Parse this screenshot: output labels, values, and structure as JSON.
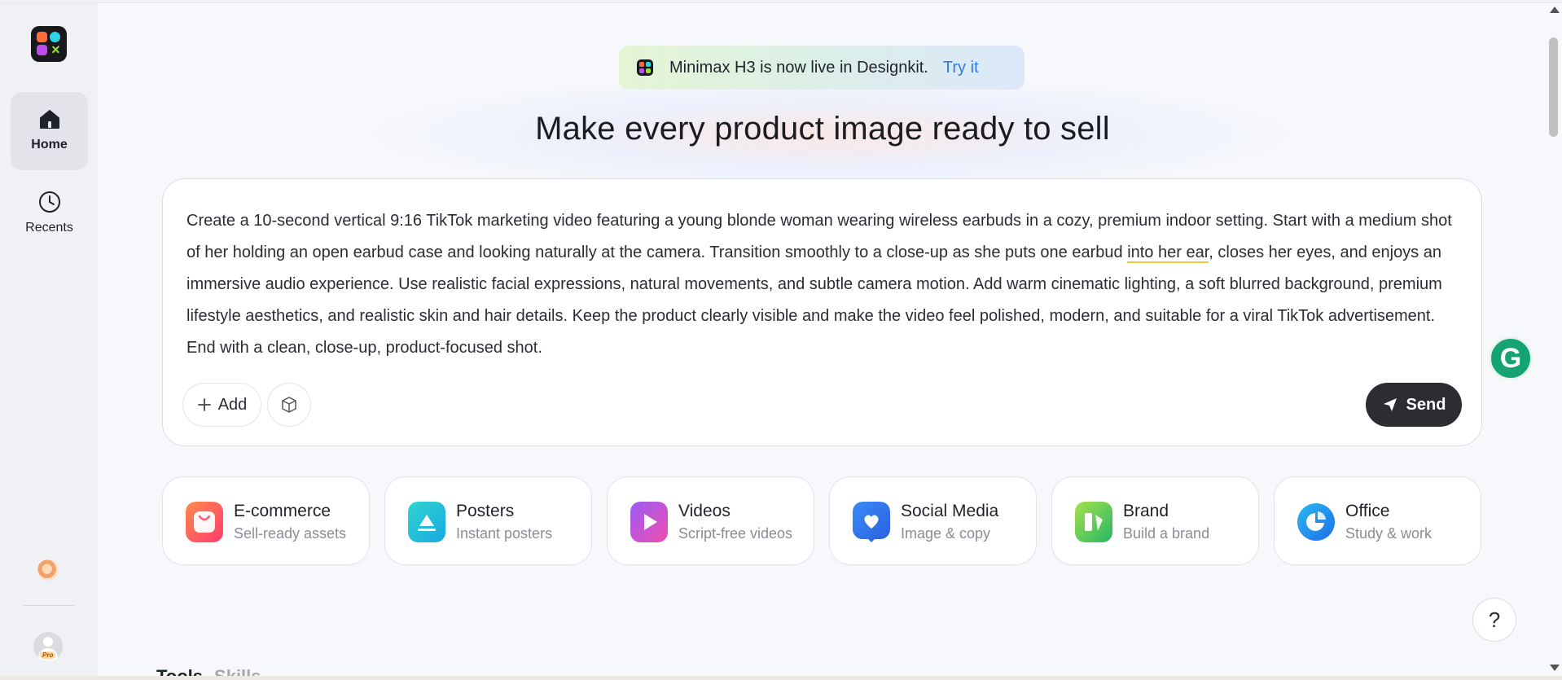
{
  "sidebar": {
    "logo_name": "designkit-logo",
    "logo_glyph": "×",
    "items": [
      {
        "label": "Home",
        "icon": "home-icon",
        "active": true
      },
      {
        "label": "Recents",
        "icon": "clock-icon",
        "active": false
      }
    ],
    "pro_badge": "Pro"
  },
  "banner": {
    "text": "Minimax H3 is now live in Designkit.",
    "link": "Try it"
  },
  "headline": "Make every product image ready to sell",
  "prompt": {
    "text_before": "Create a 10-second vertical 9:16 TikTok marketing video featuring a young blonde woman wearing wireless earbuds in a cozy, premium indoor setting. Start with a medium shot of her holding an open earbud case and looking naturally at the camera. Transition smoothly to a close-up as she puts one earbud ",
    "text_marked": "into her ear",
    "text_after": ", closes her eyes, and enjoys an immersive audio experience. Use realistic facial expressions, natural movements, and subtle camera motion. Add warm cinematic lighting, a soft blurred background, premium lifestyle aesthetics, and realistic skin and hair details. Keep the product clearly visible and make the video feel polished, modern, and suitable for a viral TikTok advertisement. End with a clean, close-up, product-focused shot.",
    "add_label": "Add",
    "send_label": "Send"
  },
  "grammarly_glyph": "G",
  "categories": [
    {
      "title": "E-commerce",
      "subtitle": "Sell-ready assets",
      "icon": "shopping-bag-icon",
      "color": "#ff5a4e"
    },
    {
      "title": "Posters",
      "subtitle": "Instant posters",
      "icon": "poster-icon",
      "color": "#19c1d6"
    },
    {
      "title": "Videos",
      "subtitle": "Script-free videos",
      "icon": "play-icon",
      "color": "#c44df0"
    },
    {
      "title": "Social Media",
      "subtitle": "Image & copy",
      "icon": "heart-chat-icon",
      "color": "#2f7be6"
    },
    {
      "title": "Brand",
      "subtitle": "Build a brand",
      "icon": "brand-icon",
      "color": "#3fbf5a"
    },
    {
      "title": "Office",
      "subtitle": "Study & work",
      "icon": "pie-chart-icon",
      "color": "#1f8cf0"
    }
  ],
  "help_label": "?",
  "tabs": {
    "first": "Tools",
    "second": "Skills"
  }
}
